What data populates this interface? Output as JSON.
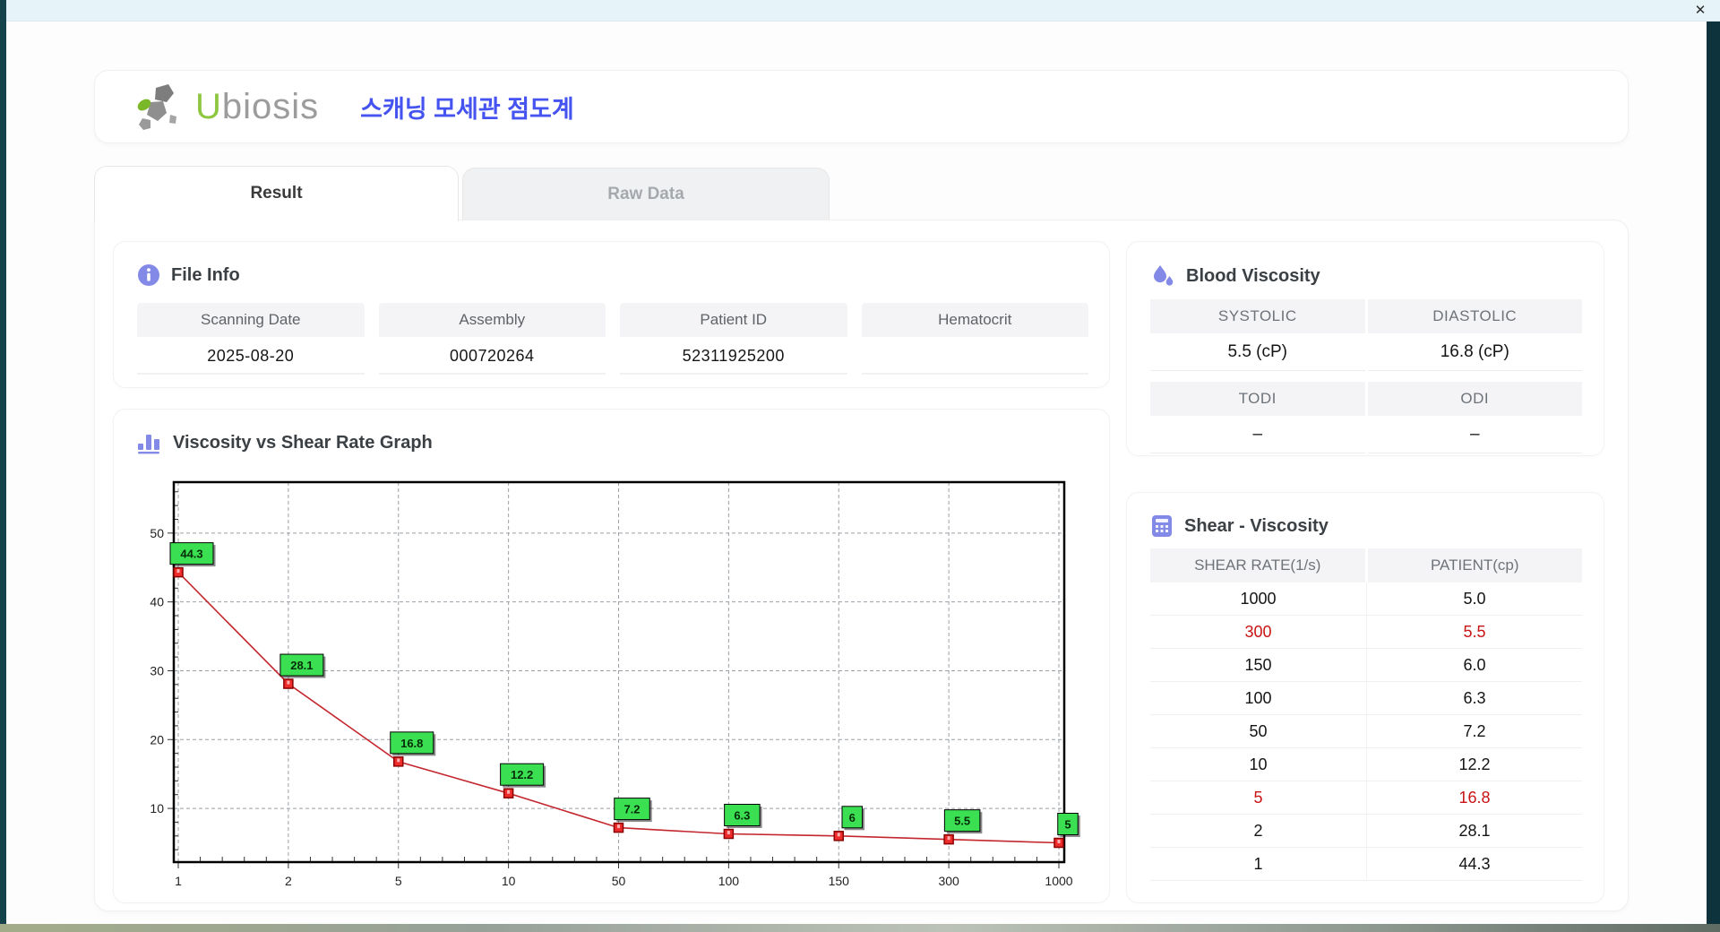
{
  "window": {
    "close_label": "✕"
  },
  "header": {
    "brand_green": "U",
    "brand_gray": "biosis",
    "app_title_korean": "스캐닝 모세관 점도계"
  },
  "tabs": [
    {
      "label": "Result",
      "active": true
    },
    {
      "label": "Raw Data",
      "active": false
    }
  ],
  "file_info": {
    "title": "File Info",
    "fields": [
      {
        "label": "Scanning Date",
        "value": "2025-08-20"
      },
      {
        "label": "Assembly",
        "value": "000720264"
      },
      {
        "label": "Patient ID",
        "value": "52311925200"
      },
      {
        "label": "Hematocrit",
        "value": ""
      }
    ]
  },
  "blood_viscosity": {
    "title": "Blood Viscosity",
    "groups": [
      {
        "cells": [
          {
            "label": "SYSTOLIC",
            "value": "5.5 (cP)"
          },
          {
            "label": "DIASTOLIC",
            "value": "16.8 (cP)"
          }
        ]
      },
      {
        "cells": [
          {
            "label": "TODI",
            "value": "–"
          },
          {
            "label": "ODI",
            "value": "–"
          }
        ]
      }
    ]
  },
  "shear_table": {
    "title": "Shear - Viscosity",
    "columns": [
      "SHEAR RATE(1/s)",
      "PATIENT(cp)"
    ],
    "rows": [
      {
        "shear": "1000",
        "patient": "5.0",
        "highlight": false
      },
      {
        "shear": "300",
        "patient": "5.5",
        "highlight": true
      },
      {
        "shear": "150",
        "patient": "6.0",
        "highlight": false
      },
      {
        "shear": "100",
        "patient": "6.3",
        "highlight": false
      },
      {
        "shear": "50",
        "patient": "7.2",
        "highlight": false
      },
      {
        "shear": "10",
        "patient": "12.2",
        "highlight": false
      },
      {
        "shear": "5",
        "patient": "16.8",
        "highlight": true
      },
      {
        "shear": "2",
        "patient": "28.1",
        "highlight": false
      },
      {
        "shear": "1",
        "patient": "44.3",
        "highlight": false
      }
    ],
    "highlight_color": "#c91414"
  },
  "chart_data": {
    "type": "line",
    "title": "Viscosity vs Shear Rate Graph",
    "x": [
      1,
      2,
      5,
      10,
      50,
      100,
      150,
      300,
      1000
    ],
    "x_scale": "category",
    "values": [
      44.3,
      28.1,
      16.8,
      12.2,
      7.2,
      6.3,
      6,
      5.5,
      5
    ],
    "point_labels": [
      "44.3",
      "28.1",
      "16.8",
      "12.2",
      "7.2",
      "6.3",
      "6",
      "5.5",
      "5"
    ],
    "xlabel": "",
    "ylabel": "",
    "y_ticks": [
      10,
      20,
      30,
      40,
      50
    ],
    "ylim": [
      2.2,
      57.4
    ],
    "grid": true,
    "x_minor_per_interval": 4,
    "y_minor_step": 2,
    "legend_position": "none",
    "line_color": "#c4262e",
    "marker": "square",
    "marker_color": "#ee2c2c",
    "marker_border": "#8b0000",
    "label_box_color": "#3be052",
    "grid_color": "#9aa0a6"
  },
  "accent_colors": {
    "icon_indigo": "#8289e6",
    "title_blue": "#4553f0",
    "logo_green": "#8dc63f"
  }
}
